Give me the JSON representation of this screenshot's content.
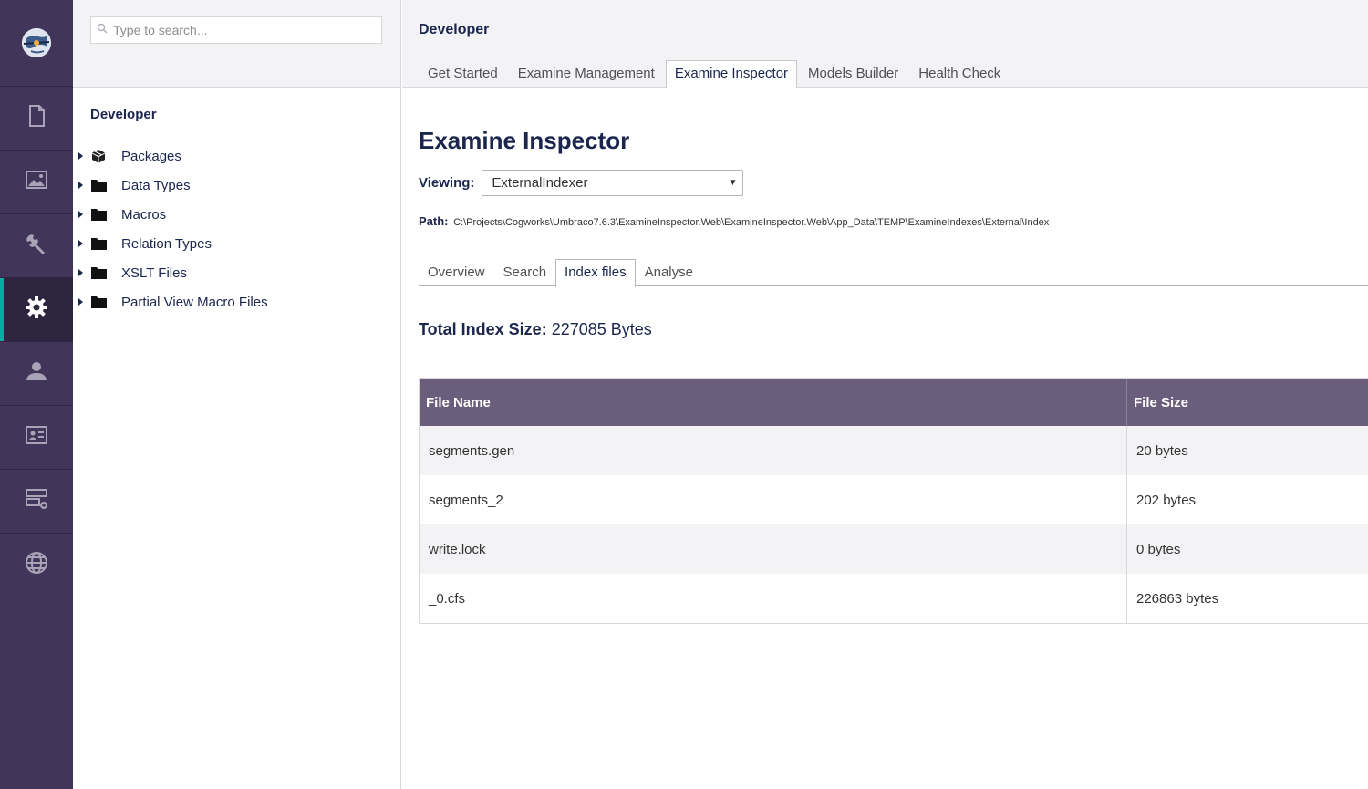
{
  "rail": {
    "logo": "umbraco-logo-icon",
    "items": [
      {
        "name": "content",
        "icon": "document-icon"
      },
      {
        "name": "media",
        "icon": "image-icon"
      },
      {
        "name": "settings",
        "icon": "wrench-icon"
      },
      {
        "name": "developer",
        "icon": "gear-icon",
        "active": true
      },
      {
        "name": "users",
        "icon": "user-icon"
      },
      {
        "name": "members",
        "icon": "id-card-icon"
      },
      {
        "name": "forms",
        "icon": "forms-icon"
      },
      {
        "name": "translation",
        "icon": "globe-icon"
      }
    ]
  },
  "tree": {
    "search_placeholder": "Type to search...",
    "title": "Developer",
    "items": [
      {
        "label": "Packages",
        "icon": "package-icon"
      },
      {
        "label": "Data Types",
        "icon": "folder-icon"
      },
      {
        "label": "Macros",
        "icon": "folder-icon"
      },
      {
        "label": "Relation Types",
        "icon": "folder-icon"
      },
      {
        "label": "XSLT Files",
        "icon": "folder-icon"
      },
      {
        "label": "Partial View Macro Files",
        "icon": "folder-icon"
      }
    ]
  },
  "header": {
    "title": "Developer",
    "tabs": [
      {
        "label": "Get Started"
      },
      {
        "label": "Examine Management"
      },
      {
        "label": "Examine Inspector",
        "active": true
      },
      {
        "label": "Models Builder"
      },
      {
        "label": "Health Check"
      }
    ]
  },
  "inspector": {
    "heading": "Examine Inspector",
    "viewing_label": "Viewing:",
    "viewing_value": "ExternalIndexer",
    "path_label": "Path:",
    "path_value": "C:\\Projects\\Cogworks\\Umbraco7.6.3\\ExamineInspector.Web\\ExamineInspector.Web\\App_Data\\TEMP\\ExamineIndexes\\External\\Index",
    "tabs": [
      {
        "label": "Overview"
      },
      {
        "label": "Search"
      },
      {
        "label": "Index files",
        "active": true
      },
      {
        "label": "Analyse"
      }
    ],
    "total_label": "Total Index Size:",
    "total_value": "227085 Bytes",
    "table": {
      "headers": [
        "File Name",
        "File Size"
      ],
      "rows": [
        [
          "segments.gen",
          "20 bytes"
        ],
        [
          "segments_2",
          "202 bytes"
        ],
        [
          "write.lock",
          "0 bytes"
        ],
        [
          "_0.cfs",
          "226863 bytes"
        ]
      ]
    }
  },
  "colors": {
    "rail_bg": "#413659",
    "accent": "#00aea2",
    "table_header": "#6a5e7c"
  }
}
